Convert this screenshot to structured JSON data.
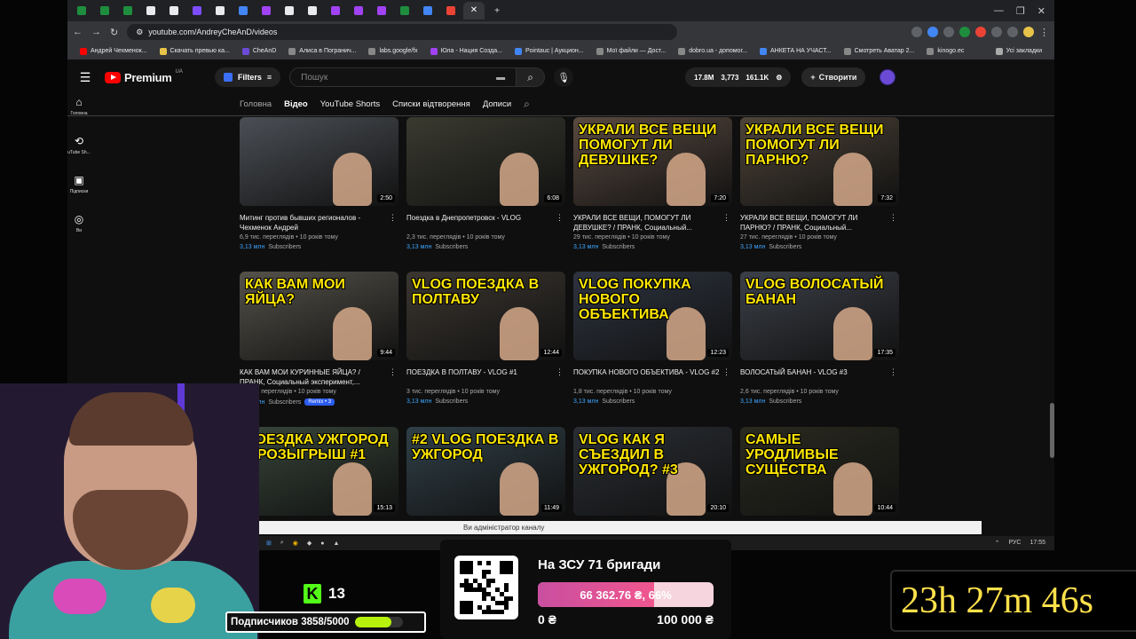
{
  "browser": {
    "url": "youtube.com/AndreyCheAnD/videos",
    "bookmarks": [
      "Андрей Чехменок...",
      "Скачать превью ка...",
      "CheAnD",
      "Алиса в Погранич...",
      "labs.google/fx",
      "Юла - Нация Созда...",
      "Pointauc | Аукцион...",
      "Мої файли — Дост...",
      "dobro.ua - допомог...",
      "АНКЕТА НА УЧАСТ...",
      "Смотреть Аватар 2...",
      "kinogo.ec"
    ],
    "all_bookmarks": "Усі закладки"
  },
  "yt": {
    "brand": "Premium",
    "region": "UA",
    "filters_label": "Filters",
    "search_placeholder": "Пошук",
    "stats": [
      "17.8M",
      "3,773",
      "161.1K"
    ],
    "create_label": "Створити",
    "sidebar": [
      "Головна",
      "uTube Sh...",
      "Підписки",
      "Ви"
    ],
    "tabs": [
      "Головна",
      "Відео",
      "YouTube Shorts",
      "Списки відтворення",
      "Дописи"
    ],
    "admin_notice": "Ви адміністратор каналу"
  },
  "videos": [
    {
      "title": "Митинг против бывших регионалов - Чехменок Андрей",
      "views": "6,9 тис. переглядів",
      "age": "10 років тому",
      "duration": "2:50",
      "subs_a": "3,13 млн",
      "subs_b": "Subscribers",
      "thumb_text": "",
      "thumb_color": "#4b4f55"
    },
    {
      "title": "Поездка в Днепропетровск - VLOG",
      "views": "2,3 тис. переглядів",
      "age": "10 років тому",
      "duration": "6:08",
      "subs_a": "3,13 млн",
      "subs_b": "Subscribers",
      "thumb_text": "",
      "thumb_color": "#3a3a30"
    },
    {
      "title": "УКРАЛИ ВСЕ ВЕЩИ, ПОМОГУТ ЛИ ДЕВУШКЕ? / ПРАНК, Социальный...",
      "views": "29 тис. переглядів",
      "age": "10 років тому",
      "duration": "7:20",
      "subs_a": "3,13 млн",
      "subs_b": "Subscribers",
      "thumb_text": "УКРАЛИ ВСЕ ВЕЩИ ПОМОГУТ ЛИ ДЕВУШКЕ?",
      "thumb_color": "#5a4a40"
    },
    {
      "title": "УКРАЛИ ВСЕ ВЕЩИ, ПОМОГУТ ЛИ ПАРНЮ? / ПРАНК, Социальный...",
      "views": "27 тис. переглядів",
      "age": "10 років тому",
      "duration": "7:32",
      "subs_a": "3,13 млн",
      "subs_b": "Subscribers",
      "thumb_text": "УКРАЛИ ВСЕ ВЕЩИ ПОМОГУТ ЛИ ПАРНЮ?",
      "thumb_color": "#4e4438"
    },
    {
      "title": "КАК ВАМ МОИ КУРИННЫЕ ЯЙЦА? / ПРАНК, Социальный эксперимент,...",
      "views": "17 тис. переглядів",
      "age": "10 років тому",
      "duration": "9:44",
      "subs_a": "3,13 млн",
      "subs_b": "Subscribers",
      "remix": "Remix • 3",
      "thumb_text": "КАК ВАМ МОИ ЯЙЦА?",
      "thumb_color": "#55524a"
    },
    {
      "title": "ПОЕЗДКА В ПОЛТАВУ - VLOG #1",
      "views": "3 тис. переглядів",
      "age": "10 років тому",
      "duration": "12:44",
      "subs_a": "3,13 млн",
      "subs_b": "Subscribers",
      "thumb_text": "VLOG ПОЕЗДКА В ПОЛТАВУ",
      "thumb_color": "#3b3630"
    },
    {
      "title": "ПОКУПКА НОВОГО ОБЪЕКТИВА - VLOG #2",
      "views": "1,8 тис. переглядів",
      "age": "10 років тому",
      "duration": "12:23",
      "subs_a": "3,13 млн",
      "subs_b": "Subscribers",
      "thumb_text": "VLOG ПОКУПКА НОВОГО ОБЪЕКТИВА",
      "thumb_color": "#2e3440"
    },
    {
      "title": "ВОЛОСАТЫЙ БАНАН - VLOG #3",
      "views": "2,6 тис. переглядів",
      "age": "10 років тому",
      "duration": "17:35",
      "subs_a": "3,13 млн",
      "subs_b": "Subscribers",
      "thumb_text": "VLOG ВОЛОСАТЫЙ БАНАН",
      "thumb_color": "#3c4048"
    },
    {
      "title": "",
      "views": "",
      "age": "",
      "duration": "15:13",
      "subs_a": "",
      "subs_b": "",
      "thumb_text": "ПОЕЗДКА УЖГОРОД + РОЗЫГРЫШ #1",
      "thumb_color": "#38463a"
    },
    {
      "title": "",
      "views": "",
      "age": "",
      "duration": "11:49",
      "subs_a": "",
      "subs_b": "",
      "thumb_text": "#2 VLOG ПОЕЗДКА В УЖГОРОД",
      "thumb_color": "#304048"
    },
    {
      "title": "",
      "views": "",
      "age": "",
      "duration": "20:10",
      "subs_a": "",
      "subs_b": "",
      "thumb_text": "VLOG КАК Я СЪЕЗДИЛ В УЖГОРОД? #3",
      "thumb_color": "#2a2e34"
    },
    {
      "title": "",
      "views": "",
      "age": "",
      "duration": "10:44",
      "subs_a": "",
      "subs_b": "",
      "thumb_text": "САМЫЕ УРОДЛИВЫЕ СУЩЕСТВА",
      "thumb_color": "#2a2a20"
    }
  ],
  "taskbar": {
    "lang": "РУС",
    "time": "17:55"
  },
  "overlay": {
    "kick_count": "13",
    "subs_goal_label": "Подписчиков 3858/5000",
    "subs_goal_fraction": 0.77,
    "donate_title": "На ЗСУ 71 бригади",
    "donate_value": "66 362.76 ₴, 66%",
    "donate_fraction": 0.66,
    "donate_min": "0 ₴",
    "donate_max": "100 000 ₴",
    "timer": "23h 27m 46s"
  },
  "colors": {
    "youtube_red": "#ff0000",
    "kick_green": "#53fc18",
    "link_blue": "#3ea6ff",
    "timer_yellow": "#ffe14a"
  }
}
